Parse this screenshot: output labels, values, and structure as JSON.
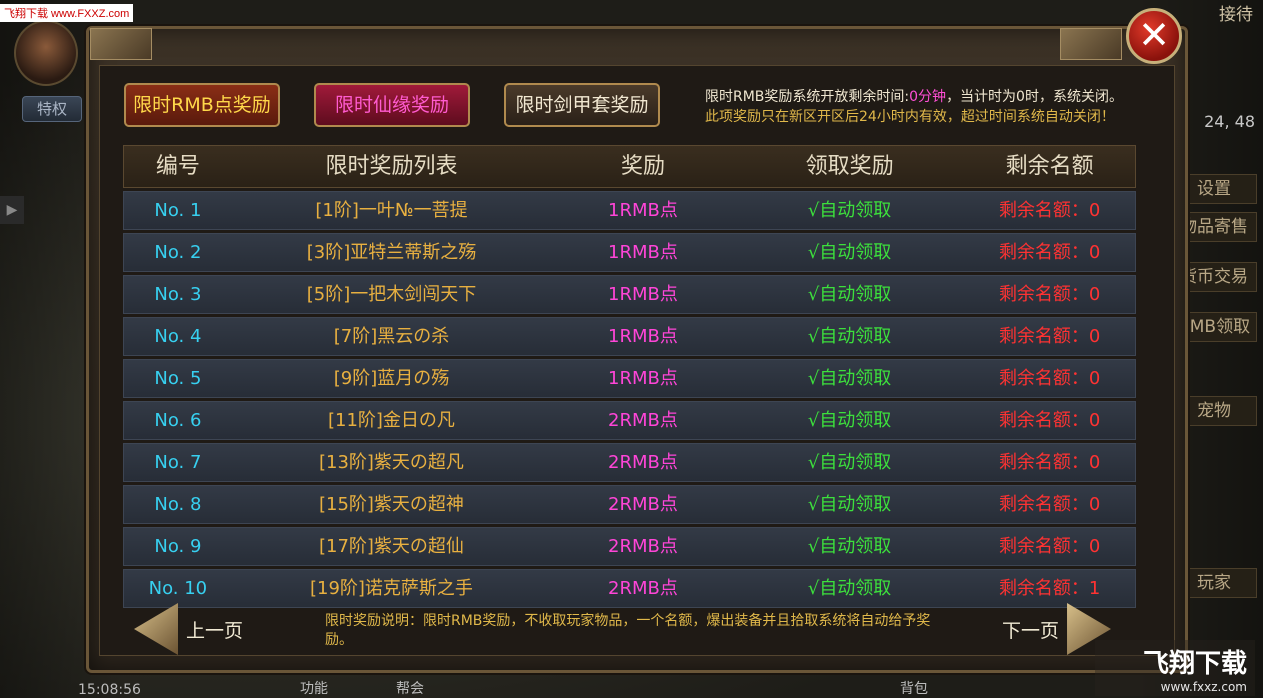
{
  "watermark": {
    "top": "飞翔下载 www.FXXZ.com",
    "brand": "飞翔下载",
    "site": "www.fxxz.com"
  },
  "hud": {
    "privilege_label": "特权",
    "top_right": "接待",
    "coords": "24, 48",
    "side_items": [
      "设置",
      "物品寄售",
      "货币交易",
      "RMB领取",
      "宠物",
      "玩家"
    ],
    "bottom_items": [
      "15:08:56",
      "功能",
      "帮会",
      "背包"
    ]
  },
  "tabs": [
    "限时RMB点奖励",
    "限时仙缘奖励",
    "限时剑甲套奖励"
  ],
  "notice": {
    "line1_prefix": "限时RMB奖励系统开放剩余时间:",
    "line1_time": "0分钟",
    "line1_suffix": "，当计时为0时，系统关闭。",
    "line2": "此项奖励只在新区开区后24小时内有效，超过时间系统自动关闭！"
  },
  "table": {
    "headers": [
      "编号",
      "限时奖励列表",
      "奖励",
      "领取奖励",
      "剩余名额"
    ],
    "rows": [
      [
        "No. 1",
        "[1阶]一叶№一菩提",
        "1RMB点",
        "√自动领取",
        "剩余名额：0"
      ],
      [
        "No. 2",
        "[3阶]亚特兰蒂斯之殇",
        "1RMB点",
        "√自动领取",
        "剩余名额：0"
      ],
      [
        "No. 3",
        "[5阶]一把木剑闯天下",
        "1RMB点",
        "√自动领取",
        "剩余名额：0"
      ],
      [
        "No. 4",
        "[7阶]黑云の杀",
        "1RMB点",
        "√自动领取",
        "剩余名额：0"
      ],
      [
        "No. 5",
        "[9阶]蓝月の殇",
        "1RMB点",
        "√自动领取",
        "剩余名额：0"
      ],
      [
        "No. 6",
        "[11阶]金日の凡",
        "2RMB点",
        "√自动领取",
        "剩余名额：0"
      ],
      [
        "No. 7",
        "[13阶]紫天の超凡",
        "2RMB点",
        "√自动领取",
        "剩余名额：0"
      ],
      [
        "No. 8",
        "[15阶]紫天の超神",
        "2RMB点",
        "√自动领取",
        "剩余名额：0"
      ],
      [
        "No. 9",
        "[17阶]紫天の超仙",
        "2RMB点",
        "√自动领取",
        "剩余名额：0"
      ],
      [
        "No. 10",
        "[19阶]诺克萨斯之手",
        "2RMB点",
        "√自动领取",
        "剩余名额：1"
      ]
    ]
  },
  "pagination": {
    "prev": "上一页",
    "next": "下一页"
  },
  "description": "限时奖励说明：限时RMB奖励，不收取玩家物品，一个名额，爆出装备并且拾取系统将自动给予奖励。",
  "close_symbol": "✕"
}
